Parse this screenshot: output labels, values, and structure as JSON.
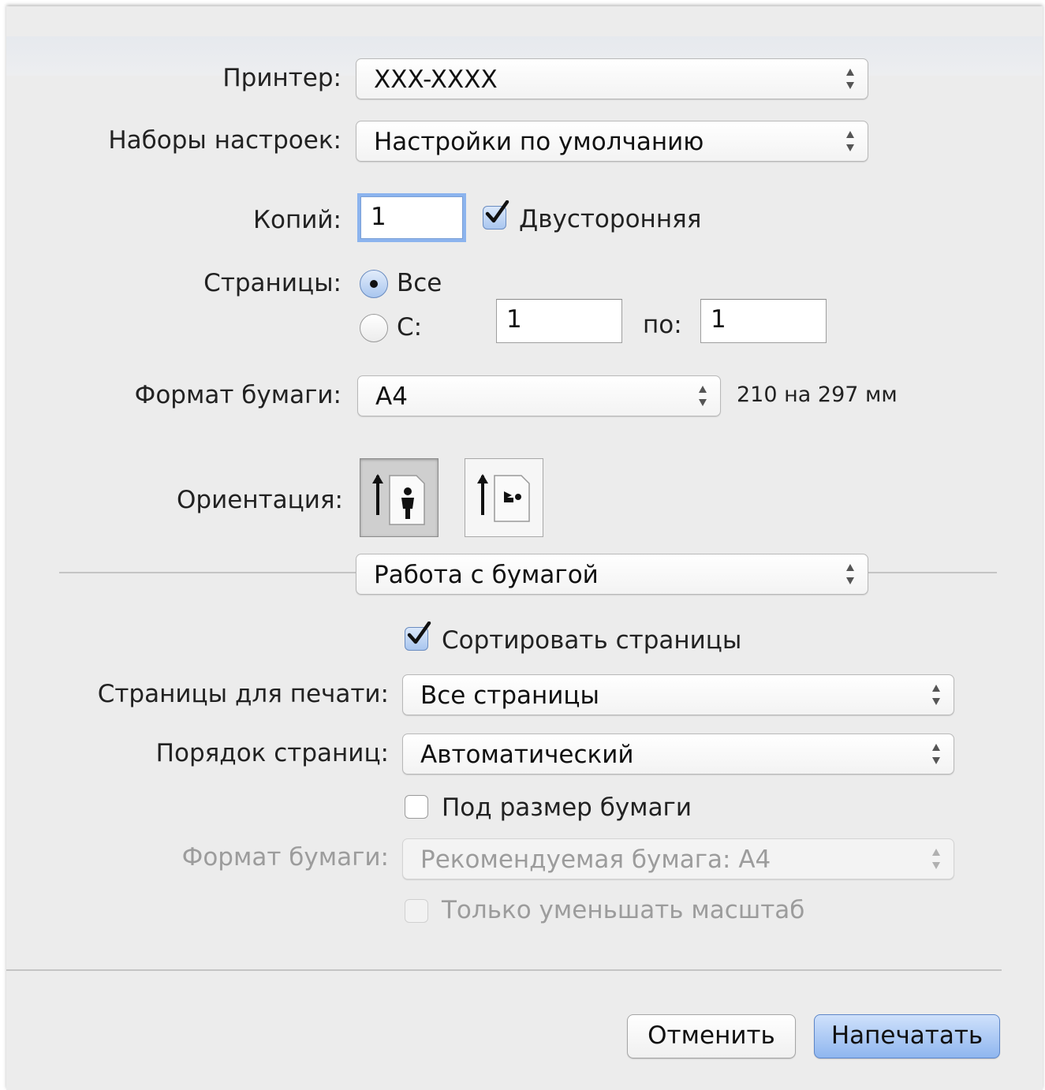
{
  "printer": {
    "label": "Принтер:",
    "value": "XXX-XXXX"
  },
  "presets": {
    "label": "Наборы настроек:",
    "value": "Настройки по умолчанию"
  },
  "copies": {
    "label": "Копий:",
    "value": "1",
    "duplex_label": "Двусторонняя",
    "duplex_checked": true
  },
  "pages": {
    "label": "Страницы:",
    "all_label": "Все",
    "range_label": "С:",
    "from_value": "1",
    "to_label": "по:",
    "to_value": "1",
    "selected": "all"
  },
  "paper_size": {
    "label": "Формат бумаги:",
    "value": "A4",
    "dimensions": "210 на 297 мм"
  },
  "orientation": {
    "label": "Ориентация:",
    "selected": "portrait"
  },
  "section_menu": {
    "value": "Работа с бумагой"
  },
  "paper_handling": {
    "collate_label": "Сортировать страницы",
    "collate_checked": true,
    "pages_to_print_label": "Страницы для печати:",
    "pages_to_print_value": "Все страницы",
    "page_order_label": "Порядок страниц:",
    "page_order_value": "Автоматический",
    "scale_to_fit_label": "Под размер бумаги",
    "scale_to_fit_checked": false,
    "dest_paper_label": "Формат бумаги:",
    "dest_paper_value": "Рекомендуемая бумага: A4",
    "scale_down_only_label": "Только уменьшать масштаб"
  },
  "buttons": {
    "cancel": "Отменить",
    "print": "Напечатать"
  }
}
